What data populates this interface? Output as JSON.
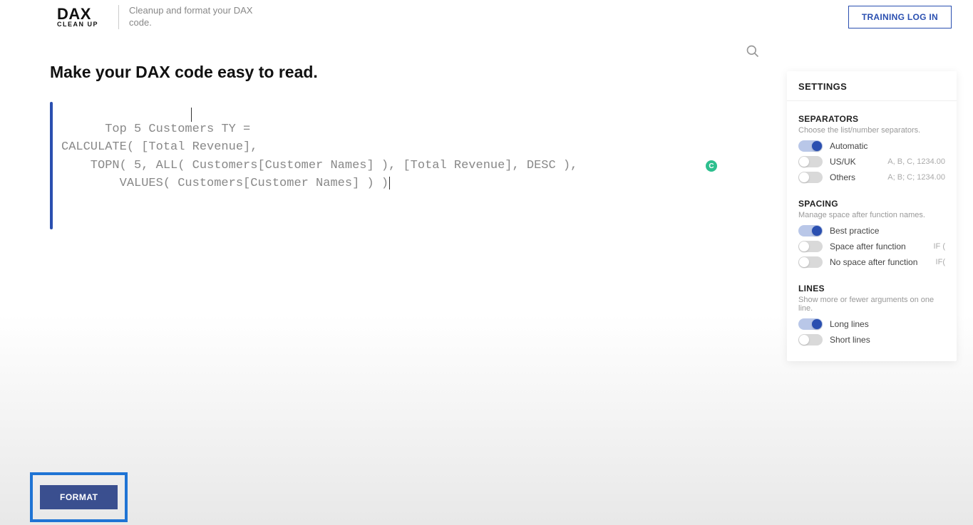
{
  "header": {
    "logo_main": "DAX",
    "logo_sub": "CLEAN UP",
    "tagline": "Cleanup and format your DAX code.",
    "login_label": "TRAINING LOG IN"
  },
  "main": {
    "heading": "Make your DAX code easy to read.",
    "code": "Top 5 Customers TY =\nCALCULATE( [Total Revenue],\n    TOPN( 5, ALL( Customers[Customer Names] ), [Total Revenue], DESC ),\n        VALUES( Customers[Customer Names] ) )",
    "status_icon": "C"
  },
  "settings": {
    "title": "SETTINGS",
    "separators": {
      "title": "SEPARATORS",
      "subtitle": "Choose the list/number separators.",
      "options": [
        {
          "label": "Automatic",
          "hint": "",
          "on": true
        },
        {
          "label": "US/UK",
          "hint": "A, B, C, 1234.00",
          "on": false
        },
        {
          "label": "Others",
          "hint": "A; B; C; 1234.00",
          "on": false
        }
      ]
    },
    "spacing": {
      "title": "SPACING",
      "subtitle": "Manage space after function names.",
      "options": [
        {
          "label": "Best practice",
          "hint": "",
          "on": true
        },
        {
          "label": "Space after function",
          "hint": "IF (",
          "on": false
        },
        {
          "label": "No space after function",
          "hint": "IF(",
          "on": false
        }
      ]
    },
    "lines": {
      "title": "LINES",
      "subtitle": "Show more or fewer arguments on one line.",
      "options": [
        {
          "label": "Long lines",
          "hint": "",
          "on": true
        },
        {
          "label": "Short lines",
          "hint": "",
          "on": false
        }
      ]
    }
  },
  "actions": {
    "format_label": "FORMAT"
  }
}
